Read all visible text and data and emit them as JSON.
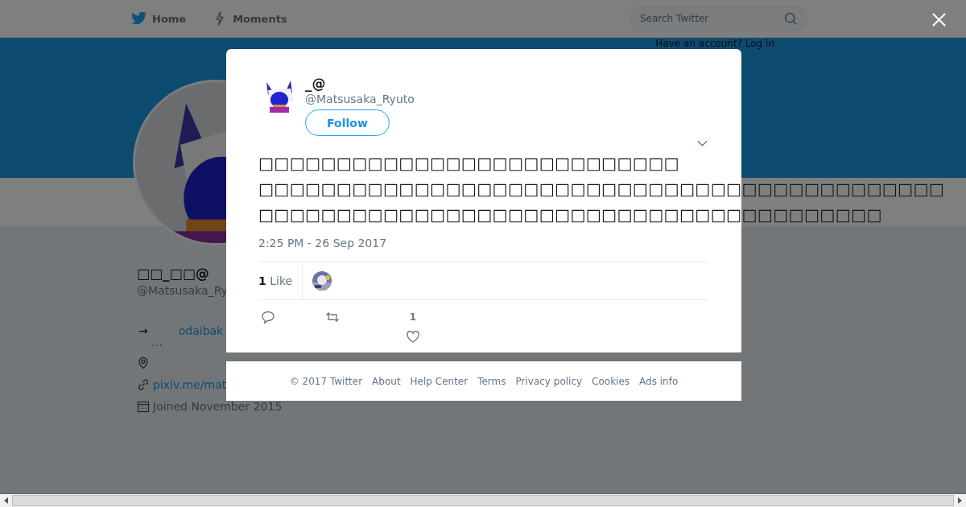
{
  "nav": {
    "items": [
      {
        "label": "Home",
        "kind": "home"
      },
      {
        "label": "Moments",
        "kind": "moments"
      }
    ],
    "search": {
      "placeholder": "Search Twitter"
    },
    "login_prompt": "Have an account? Log in"
  },
  "profile": {
    "name": "□□_□□@",
    "handle": "@Matsusaka_Ry",
    "bio_arrow": "→",
    "bio_link": "odaibak",
    "bio_more": "…",
    "link": "pixiv.me/mat",
    "joined": "Joined November 2015"
  },
  "tweet": {
    "name": "_@",
    "handle": "@Matsusaka_Ryuto",
    "follow": "Follow",
    "text_lines": [
      "□□□□□□□□□□□□□□□□□□□□□□□□□□□",
      "□□□□□□□□□□□□□□□□□□□□□□□□□□□□□□□□□□□□□□□□□□□□",
      "□□□□□□□□□□□□□□□□□□□□□□□□□□□□□□□□□□□□□□□□"
    ],
    "time": "2:25 PM - 26 Sep 2017",
    "likes_count": "1",
    "likes_label": "Like",
    "actions": [
      {
        "kind": "reply"
      },
      {
        "kind": "retweet"
      },
      {
        "kind": "like",
        "count": "1"
      }
    ]
  },
  "footer": [
    "© 2017 Twitter",
    "About",
    "Help Center",
    "Terms",
    "Privacy policy",
    "Cookies",
    "Ads info"
  ]
}
